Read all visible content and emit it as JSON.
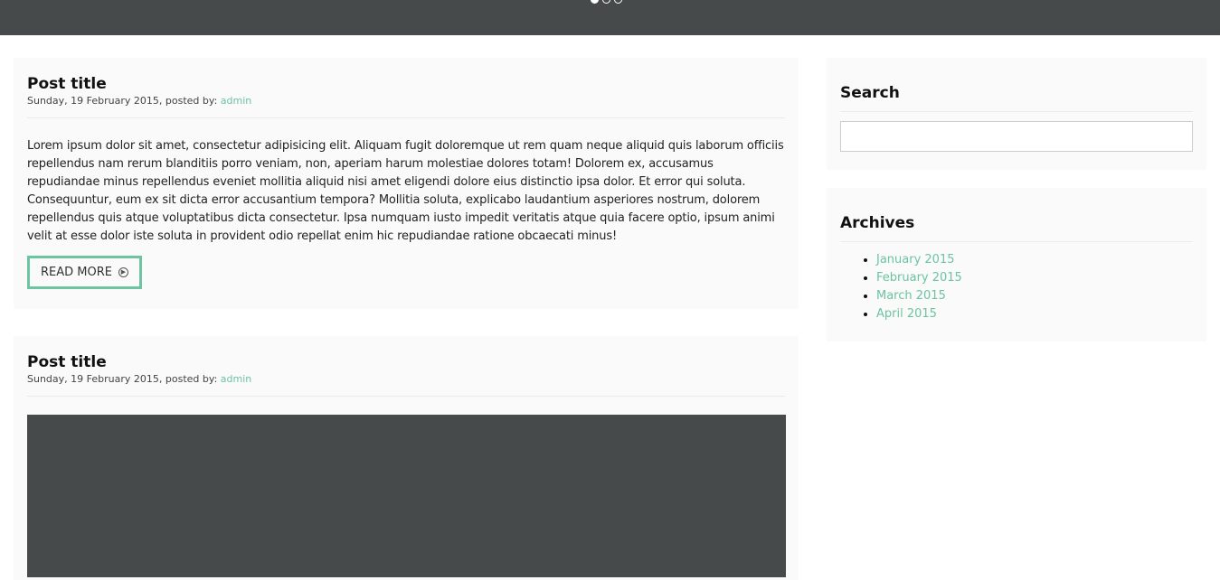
{
  "slider": {
    "dots": [
      {
        "active": true
      },
      {
        "active": false
      },
      {
        "active": false
      }
    ]
  },
  "posts": [
    {
      "title": "Post title",
      "date": "Sunday, 19 February 2015, posted by:",
      "author": "admin",
      "body": "Lorem ipsum dolor sit amet, consectetur adipisicing elit. Aliquam fugit doloremque ut rem quam neque aliquid quis laborum officiis repellendus nam rerum blanditiis porro veniam, non, aperiam harum molestiae dolores totam! Dolorem ex, accusamus repudiandae minus repellendus eveniet mollitia aliquid nisi amet eligendi dolore eius distinctio ipsa dolor. Et error qui soluta. Consequuntur, eum ex sit dicta error accusantium tempora? Mollitia soluta, explicabo laudantium asperiores nostrum, dolorem repellendus quis atque voluptatibus dicta consectetur. Ipsa numquam iusto impedit veritatis atque quia facere optio, ipsum animi velit at esse dolor iste soluta in provident odio repellat enim hic repudiandae ratione obcaecati minus!",
      "read_more": "READ MORE",
      "read_more_icon": "arrow-circle-right-icon"
    },
    {
      "title": "Post title",
      "date": "Sunday, 19 February 2015, posted by:",
      "author": "admin"
    }
  ],
  "sidebar": {
    "search": {
      "title": "Search",
      "placeholder": ""
    },
    "archives": {
      "title": "Archives",
      "items": [
        {
          "label": "January 2015"
        },
        {
          "label": "February 2015"
        },
        {
          "label": "March 2015"
        },
        {
          "label": "April 2015"
        }
      ]
    }
  },
  "colors": {
    "accent": "#6cc4a1",
    "hero_bg": "#464a4b",
    "panel_bg": "#fafafa"
  }
}
